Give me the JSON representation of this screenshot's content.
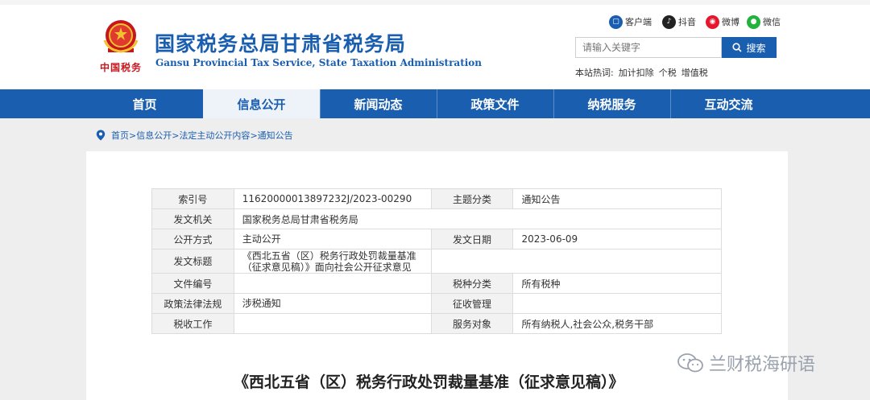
{
  "header": {
    "emblem_signature": "中国税务",
    "title": "国家税务总局甘肃省税务局",
    "subtitle": "Gansu Provincial Tax Service, State Taxation Administration",
    "social": [
      {
        "label": "客户端",
        "icon": "mobile-client-icon",
        "color": "#1a5eb0"
      },
      {
        "label": "抖音",
        "icon": "douyin-icon",
        "color": "#222222"
      },
      {
        "label": "微博",
        "icon": "weibo-icon",
        "color": "#e6162d"
      },
      {
        "label": "微信",
        "icon": "wechat-icon",
        "color": "#21b33b"
      }
    ],
    "search": {
      "placeholder": "请输入关键字",
      "button": "搜索"
    },
    "hot_label": "本站热词:",
    "hot_words": [
      "加计扣除",
      "个税",
      "增值税"
    ]
  },
  "nav": {
    "items": [
      "首页",
      "信息公开",
      "新闻动态",
      "政策文件",
      "纳税服务",
      "互动交流"
    ],
    "active_index": 1
  },
  "breadcrumb": [
    "首页",
    "信息公开",
    "法定主动公开内容",
    "通知公告"
  ],
  "meta": {
    "rows": [
      {
        "l1": "索引号",
        "v1": "11620000013897232J/2023-00290",
        "l2": "主题分类",
        "v2": "通知公告"
      },
      {
        "l1": "发文机关",
        "v1": "国家税务总局甘肃省税务局"
      },
      {
        "l1": "公开方式",
        "v1": "主动公开",
        "l2": "发文日期",
        "v2": "2023-06-09"
      },
      {
        "l1": "发文标题",
        "v1": "《西北五省（区）税务行政处罚裁量基准（征求意见稿）》面向社会公开征求意见"
      },
      {
        "l1": "文件编号",
        "v1": "",
        "l2": "税种分类",
        "v2": "所有税种"
      },
      {
        "l1": "政策法律法规",
        "v1": "涉税通知",
        "l2": "征收管理",
        "v2": ""
      },
      {
        "l1": "税收工作",
        "v1": "",
        "l2": "服务对象",
        "v2": "所有纳税人,社会公众,税务干部"
      }
    ]
  },
  "document_title": "《西北五省（区）税务行政处罚裁量基准（征求意见稿）》",
  "watermark": "兰财税海研语",
  "colors": {
    "brand_blue": "#1a5eb0",
    "emblem_red": "#c8161d",
    "emblem_gold": "#f2c230"
  }
}
